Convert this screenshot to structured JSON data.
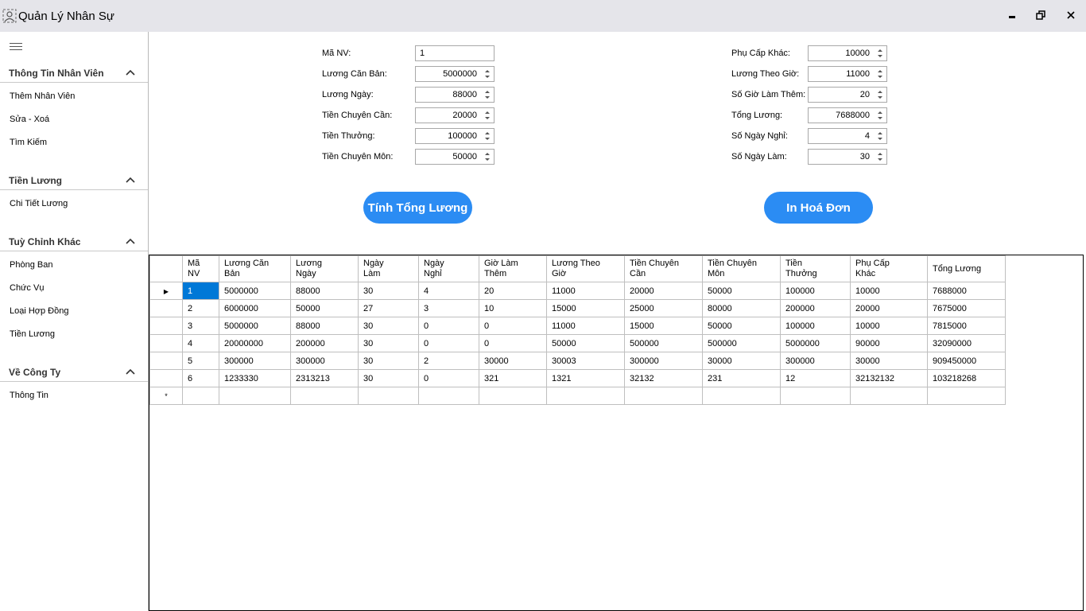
{
  "window": {
    "title": "Quản Lý Nhân Sự",
    "icons": [
      "app-icon",
      "minimize-icon",
      "restore-icon",
      "close-icon"
    ]
  },
  "sidebar": {
    "sections": [
      {
        "title": "Thông Tin Nhân Viên",
        "items": [
          "Thêm Nhân Viên",
          "Sửa - Xoá",
          "Tìm Kiếm"
        ]
      },
      {
        "title": "Tiền Lương",
        "items": [
          "Chi Tiết Lương"
        ]
      },
      {
        "title": "Tuỳ Chỉnh Khác",
        "items": [
          "Phòng Ban",
          "Chức Vụ",
          "Loại Hợp Đồng",
          "Tiền Lương"
        ]
      },
      {
        "title": "Về Công Ty",
        "items": [
          "Thông Tin"
        ]
      }
    ]
  },
  "form": {
    "left": [
      {
        "label": "Mã NV:",
        "value": "1"
      },
      {
        "label": "Lương Căn Bản:",
        "value": "5000000"
      },
      {
        "label": "Lương Ngày:",
        "value": "88000"
      },
      {
        "label": "Tiền Chuyên Cần:",
        "value": "20000"
      },
      {
        "label": "Tiền Thưởng:",
        "value": "100000"
      },
      {
        "label": "Tiền Chuyên Môn:",
        "value": "50000"
      }
    ],
    "right": [
      {
        "label": "Phụ Cấp Khác:",
        "value": "10000"
      },
      {
        "label": "Lương Theo Giờ:",
        "value": "11000"
      },
      {
        "label": "Số Giờ Làm Thêm:",
        "value": "20"
      },
      {
        "label": "Tổng Lương:",
        "value": "7688000"
      },
      {
        "label": "Số Ngày Nghỉ:",
        "value": "4"
      },
      {
        "label": "Số Ngày Làm:",
        "value": "30"
      }
    ],
    "buttons": {
      "calculate": "Tính Tổng Lương",
      "print": "In Hoá Đơn"
    }
  },
  "grid": {
    "columns": [
      [
        "Mã",
        "NV"
      ],
      [
        "Lương Căn",
        "Bản"
      ],
      [
        "Lương",
        "Ngày"
      ],
      [
        "Ngày",
        "Làm"
      ],
      [
        "Ngày",
        "Nghỉ"
      ],
      [
        "Giờ Làm",
        "Thêm"
      ],
      [
        "Lương Theo",
        "Giờ"
      ],
      [
        "Tiền Chuyên",
        "Cần"
      ],
      [
        "Tiền Chuyên",
        "Môn"
      ],
      [
        "Tiền",
        "Thưởng"
      ],
      [
        "Phụ Cấp",
        "Khác"
      ],
      [
        "Tổng Lương",
        ""
      ]
    ],
    "rows": [
      [
        "1",
        "5000000",
        "88000",
        "30",
        "4",
        "20",
        "11000",
        "20000",
        "50000",
        "100000",
        "10000",
        "7688000"
      ],
      [
        "2",
        "6000000",
        "50000",
        "27",
        "3",
        "10",
        "15000",
        "25000",
        "80000",
        "200000",
        "20000",
        "7675000"
      ],
      [
        "3",
        "5000000",
        "88000",
        "30",
        "0",
        "0",
        "11000",
        "15000",
        "50000",
        "100000",
        "10000",
        "7815000"
      ],
      [
        "4",
        "20000000",
        "200000",
        "30",
        "0",
        "0",
        "50000",
        "500000",
        "500000",
        "5000000",
        "90000",
        "32090000"
      ],
      [
        "5",
        "300000",
        "300000",
        "30",
        "2",
        "30000",
        "30003",
        "300000",
        "30000",
        "300000",
        "30000",
        "909450000"
      ],
      [
        "6",
        "1233330",
        "2313213",
        "30",
        "0",
        "321",
        "1321",
        "32132",
        "231",
        "12",
        "32132132",
        "103218268"
      ]
    ],
    "current_row_marker": "▶",
    "new_row_marker": "*"
  },
  "colors": {
    "accent": "#2b8cf3",
    "titlebar": "#e5e5ea",
    "selection": "#0078d7"
  }
}
